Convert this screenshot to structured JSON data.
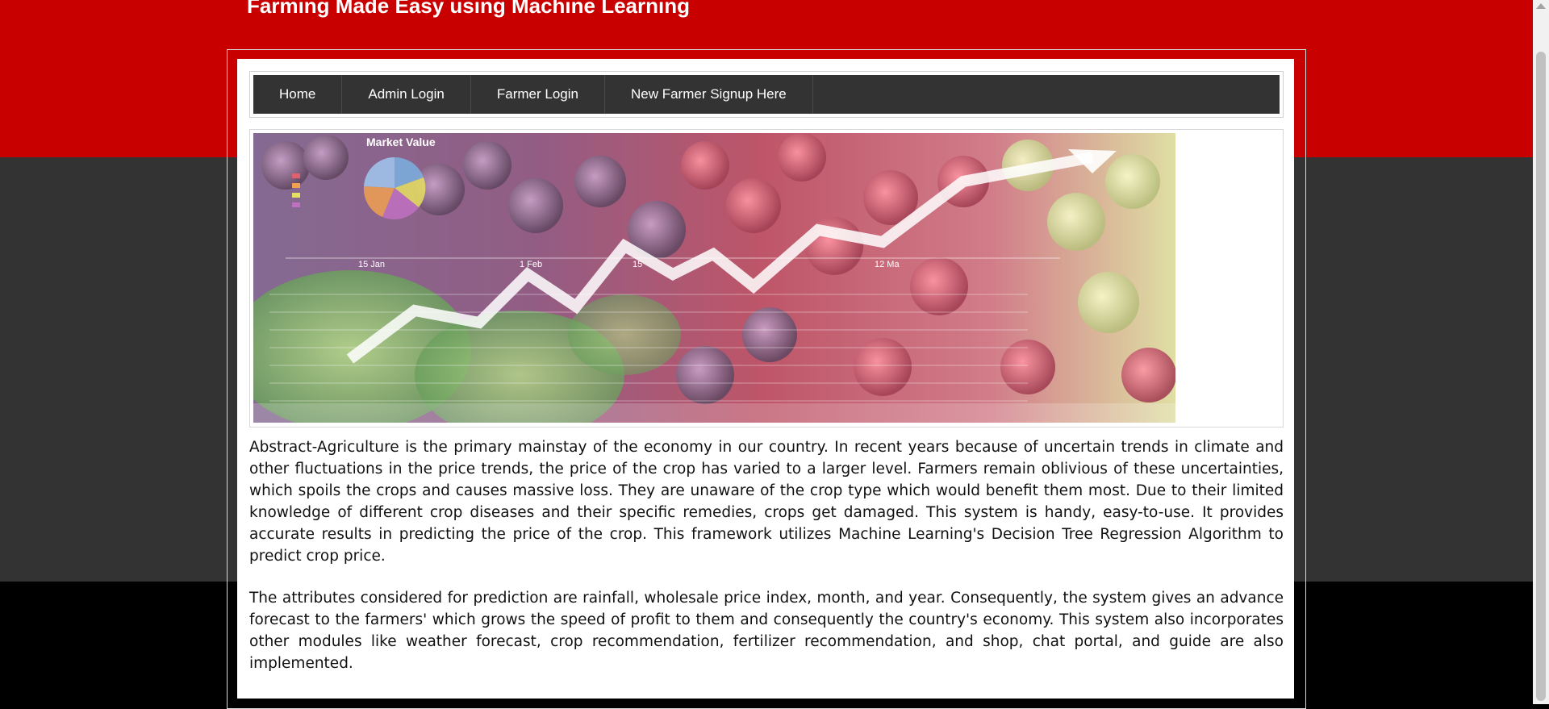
{
  "site": {
    "title": "Farming Made Easy using Machine Learning"
  },
  "nav": {
    "items": [
      {
        "label": "Home"
      },
      {
        "label": "Admin Login"
      },
      {
        "label": "Farmer Login"
      },
      {
        "label": "New Farmer Signup Here"
      }
    ]
  },
  "banner": {
    "chart_title": "Market Value",
    "chart_axis_labels": [
      "15 Jan",
      "1 Feb",
      "15",
      "12 Ma"
    ]
  },
  "content": {
    "paragraph1": "Abstract-Agriculture is the primary mainstay of the economy in our country. In recent years because of uncertain trends in climate and other fluctuations in the price trends, the price of the crop has varied to a larger level. Farmers remain oblivious of these uncertainties, which spoils the crops and causes massive loss. They are unaware of the crop type which would benefit them most. Due to their limited knowledge of different crop diseases and their specific remedies, crops get damaged. This system is handy, easy-to-use. It provides accurate results in predicting the price of the crop. This framework utilizes Machine Learning's Decision Tree Regression Algorithm to predict crop price.",
    "paragraph2": "The attributes considered for prediction are rainfall, wholesale price index, month, and year. Consequently, the system gives an advance forecast to the farmers' which grows the speed of profit to them and consequently the country's economy. This system also incorporates other modules like weather forecast, crop recommendation, fertilizer recommendation, and shop, chat portal, and guide are also implemented."
  },
  "colors": {
    "header_red": "#c80000",
    "band_gray": "#333333",
    "nav_bg": "#333333",
    "footer_black": "#000000"
  }
}
